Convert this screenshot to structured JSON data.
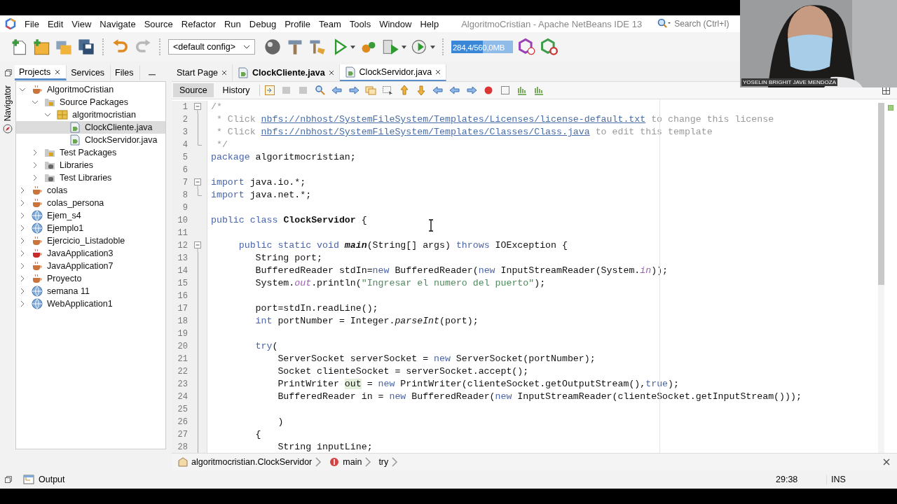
{
  "window": {
    "title": "AlgoritmoCristian - Apache NetBeans IDE 13"
  },
  "menu": [
    "File",
    "Edit",
    "View",
    "Navigate",
    "Source",
    "Refactor",
    "Run",
    "Debug",
    "Profile",
    "Team",
    "Tools",
    "Window",
    "Help"
  ],
  "search": {
    "placeholder": "Search (Ctrl+I)"
  },
  "toolbar": {
    "config": "<default config>",
    "memory": {
      "text": "284,4/560,0MB",
      "level": 0.51
    }
  },
  "left_tabs": [
    {
      "label": "Projects",
      "selected": true,
      "closable": true
    },
    {
      "label": "Services",
      "selected": false,
      "closable": false
    },
    {
      "label": "Files",
      "selected": false,
      "closable": false
    }
  ],
  "navigator": {
    "label": "Navigator"
  },
  "project_tree": [
    {
      "label": "AlgoritmoCristian",
      "kind": "project",
      "error": false,
      "expanded": true,
      "selected": false,
      "children": [
        {
          "label": "Source Packages",
          "kind": "source-folder",
          "expanded": true,
          "selected": false,
          "children": [
            {
              "label": "algoritmocristian",
              "kind": "package",
              "expanded": true,
              "selected": false,
              "children": [
                {
                  "label": "ClockCliente.java",
                  "kind": "java-file",
                  "selected": true
                },
                {
                  "label": "ClockServidor.java",
                  "kind": "java-file",
                  "selected": false
                }
              ]
            }
          ]
        },
        {
          "label": "Test Packages",
          "kind": "source-folder",
          "expanded": false,
          "selected": false
        },
        {
          "label": "Libraries",
          "kind": "library",
          "expanded": false,
          "selected": false
        },
        {
          "label": "Test Libraries",
          "kind": "library",
          "expanded": false,
          "selected": false
        }
      ]
    },
    {
      "label": "colas",
      "kind": "project",
      "error": false,
      "expanded": false,
      "selected": false
    },
    {
      "label": "colas_persona",
      "kind": "project",
      "error": false,
      "expanded": false,
      "selected": false
    },
    {
      "label": "Ejem_s4",
      "kind": "web-project",
      "expanded": false,
      "selected": false
    },
    {
      "label": "Ejemplo1",
      "kind": "web-project",
      "expanded": false,
      "selected": false
    },
    {
      "label": "Ejercicio_Listadoble",
      "kind": "project",
      "error": false,
      "expanded": false,
      "selected": false
    },
    {
      "label": "JavaApplication3",
      "kind": "project",
      "error": true,
      "expanded": false,
      "selected": false
    },
    {
      "label": "JavaApplication7",
      "kind": "project",
      "error": false,
      "expanded": false,
      "selected": false
    },
    {
      "label": "Proyecto",
      "kind": "project",
      "error": false,
      "expanded": false,
      "selected": false
    },
    {
      "label": "semana 11",
      "kind": "web-project",
      "expanded": false,
      "selected": false
    },
    {
      "label": "WebApplication1",
      "kind": "web-project",
      "expanded": false,
      "selected": false
    }
  ],
  "editor_tabs": [
    {
      "label": "Start Page",
      "selected": false,
      "modified": false,
      "kind": "page"
    },
    {
      "label": "ClockCliente.java",
      "selected": false,
      "modified": true,
      "kind": "java-file"
    },
    {
      "label": "ClockServidor.java",
      "selected": true,
      "modified": false,
      "kind": "java-file"
    }
  ],
  "view_modes": [
    {
      "label": "Source",
      "selected": true
    },
    {
      "label": "History",
      "selected": false
    }
  ],
  "code_lines": [
    {
      "number": "1",
      "kind": "fold-start",
      "tokens": [
        {
          "kind": "comment",
          "text": "/*"
        }
      ]
    },
    {
      "number": "2",
      "kind": "fold-body",
      "tokens": [
        {
          "kind": "comment",
          "text": " * Click "
        },
        {
          "kind": "link",
          "text": "nbfs://nbhost/SystemFileSystem/Templates/Licenses/license-default.txt"
        },
        {
          "kind": "comment",
          "text": " to change this license"
        }
      ]
    },
    {
      "number": "3",
      "kind": "fold-body",
      "tokens": [
        {
          "kind": "comment",
          "text": " * Click "
        },
        {
          "kind": "link",
          "text": "nbfs://nbhost/SystemFileSystem/Templates/Classes/Class.java"
        },
        {
          "kind": "comment",
          "text": " to edit this template"
        }
      ]
    },
    {
      "number": "4",
      "kind": "fold-end",
      "tokens": [
        {
          "kind": "comment",
          "text": " */"
        }
      ]
    },
    {
      "number": "5",
      "kind": "plain",
      "tokens": [
        {
          "kind": "kw",
          "text": "package"
        },
        {
          "kind": "plain",
          "text": " algoritmocristian;"
        }
      ]
    },
    {
      "number": "6",
      "kind": "plain"
    },
    {
      "number": "7",
      "kind": "fold-start",
      "tokens": [
        {
          "kind": "kw",
          "text": "import"
        },
        {
          "kind": "plain",
          "text": " java.io.*;"
        }
      ]
    },
    {
      "number": "8",
      "kind": "fold-end",
      "tokens": [
        {
          "kind": "kw",
          "text": "import"
        },
        {
          "kind": "plain",
          "text": " java.net.*;"
        }
      ]
    },
    {
      "number": "9",
      "kind": "plain"
    },
    {
      "number": "10",
      "kind": "plain",
      "tokens": [
        {
          "kind": "kw",
          "text": "public class "
        },
        {
          "kind": "bold",
          "text": "ClockServidor"
        },
        {
          "kind": "plain",
          "text": " {"
        }
      ]
    },
    {
      "number": "11",
      "kind": "plain"
    },
    {
      "number": "12",
      "kind": "fold-start",
      "tokens": [
        {
          "kind": "kw",
          "text": "     public static void "
        },
        {
          "kind": "bold-italic",
          "text": "main"
        },
        {
          "kind": "plain",
          "text": "(String[] args) "
        },
        {
          "kind": "kw",
          "text": "throws"
        },
        {
          "kind": "plain",
          "text": " IOException {"
        }
      ]
    },
    {
      "number": "13",
      "kind": "fold-body",
      "tokens": [
        {
          "kind": "plain",
          "text": "        String port;"
        }
      ]
    },
    {
      "number": "14",
      "kind": "fold-body",
      "tokens": [
        {
          "kind": "plain",
          "text": "        BufferedReader stdIn="
        },
        {
          "kind": "kw",
          "text": "new"
        },
        {
          "kind": "plain",
          "text": " BufferedReader("
        },
        {
          "kind": "kw",
          "text": "new"
        },
        {
          "kind": "plain",
          "text": " InputStreamReader(System."
        },
        {
          "kind": "field",
          "text": "in"
        },
        {
          "kind": "plain",
          "text": "));"
        }
      ]
    },
    {
      "number": "15",
      "kind": "fold-body",
      "tokens": [
        {
          "kind": "plain",
          "text": "        System."
        },
        {
          "kind": "field",
          "text": "out"
        },
        {
          "kind": "plain",
          "text": ".println("
        },
        {
          "kind": "string",
          "text": "\"Ingresar el numero del puerto\""
        },
        {
          "kind": "plain",
          "text": ");"
        }
      ]
    },
    {
      "number": "16",
      "kind": "fold-body"
    },
    {
      "number": "17",
      "kind": "fold-body",
      "tokens": [
        {
          "kind": "plain",
          "text": "        port=stdIn.readLine();"
        }
      ]
    },
    {
      "number": "18",
      "kind": "fold-body",
      "tokens": [
        {
          "kind": "kw",
          "text": "        int"
        },
        {
          "kind": "plain",
          "text": " portNumber = Integer."
        },
        {
          "kind": "italic",
          "text": "parseInt"
        },
        {
          "kind": "plain",
          "text": "(port);"
        }
      ]
    },
    {
      "number": "19",
      "kind": "fold-body"
    },
    {
      "number": "20",
      "kind": "fold-body",
      "tokens": [
        {
          "kind": "kw",
          "text": "        try"
        },
        {
          "kind": "plain",
          "text": "("
        }
      ]
    },
    {
      "number": "21",
      "kind": "fold-body",
      "tokens": [
        {
          "kind": "plain",
          "text": "            ServerSocket serverSocket = "
        },
        {
          "kind": "kw",
          "text": "new"
        },
        {
          "kind": "plain",
          "text": " ServerSocket(portNumber);"
        }
      ]
    },
    {
      "number": "22",
      "kind": "fold-body",
      "tokens": [
        {
          "kind": "plain",
          "text": "            Socket clienteSocket = serverSocket.accept();"
        }
      ]
    },
    {
      "number": "23",
      "kind": "fold-body",
      "tokens": [
        {
          "kind": "plain",
          "text": "            PrintWriter "
        },
        {
          "kind": "mark",
          "text": "out"
        },
        {
          "kind": "plain",
          "text": " = "
        },
        {
          "kind": "kw",
          "text": "new"
        },
        {
          "kind": "plain",
          "text": " PrintWriter(clienteSocket.getOutputStream(),"
        },
        {
          "kind": "kw",
          "text": "true"
        },
        {
          "kind": "plain",
          "text": ");"
        }
      ]
    },
    {
      "number": "24",
      "kind": "fold-body",
      "tokens": [
        {
          "kind": "plain",
          "text": "            BufferedReader in = "
        },
        {
          "kind": "kw",
          "text": "new"
        },
        {
          "kind": "plain",
          "text": " BufferedReader("
        },
        {
          "kind": "kw",
          "text": "new"
        },
        {
          "kind": "plain",
          "text": " InputStreamReader(clienteSocket.getInputStream()));"
        }
      ]
    },
    {
      "number": "25",
      "kind": "fold-body"
    },
    {
      "number": "26",
      "kind": "fold-body",
      "tokens": [
        {
          "kind": "plain",
          "text": "            )"
        }
      ]
    },
    {
      "number": "27",
      "kind": "fold-body",
      "tokens": [
        {
          "kind": "plain",
          "text": "        {"
        }
      ]
    },
    {
      "number": "28",
      "kind": "fold-body",
      "tokens": [
        {
          "kind": "plain",
          "text": "            String inputLine;"
        }
      ]
    }
  ],
  "breadcrumbs": [
    {
      "kind": "class",
      "label": "algoritmocristian.ClockServidor"
    },
    {
      "kind": "method",
      "label": "main"
    },
    {
      "kind": "block",
      "label": "try"
    }
  ],
  "status_bar": {
    "output_label": "Output",
    "position": "29:38",
    "mode": "INS"
  },
  "video_call": {
    "kind": "picture",
    "participant": "YOSELIN BRIGHIT JAVE MENDOZA"
  }
}
